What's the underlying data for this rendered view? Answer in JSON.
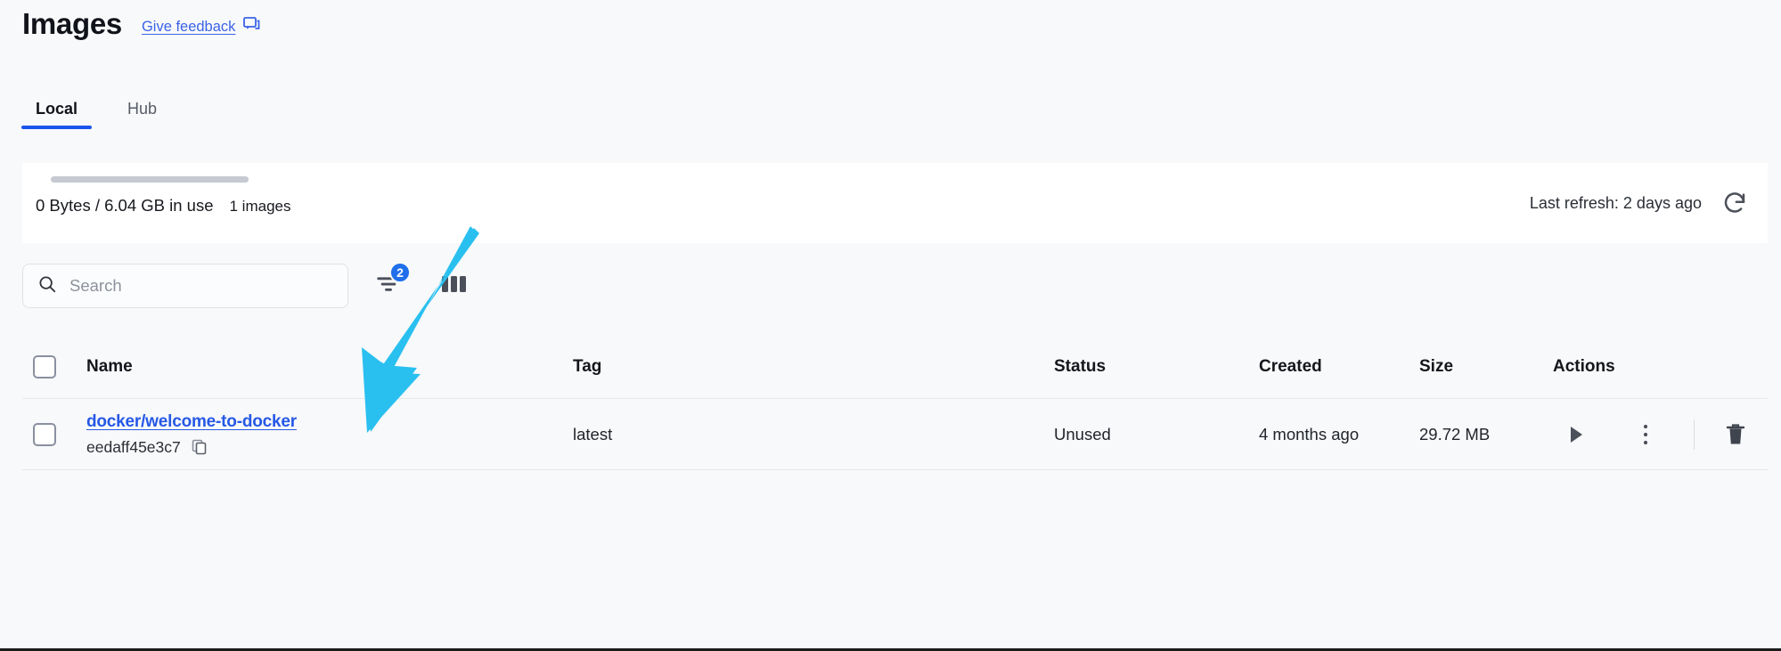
{
  "header": {
    "title": "Images",
    "feedback_label": "Give feedback",
    "feedback_icon": "feedback-message-icon"
  },
  "tabs": [
    {
      "label": "Local",
      "active": true
    },
    {
      "label": "Hub",
      "active": false
    }
  ],
  "usage": {
    "disk_text": "0 Bytes / 6.04 GB in use",
    "image_count_text": "1 images",
    "bar_fill_percent": 0,
    "last_refresh_label": "Last refresh: 2 days ago",
    "refresh_icon": "refresh-icon"
  },
  "toolbar": {
    "search_placeholder": "Search",
    "search_value": "",
    "search_icon": "search-icon",
    "filter_icon": "filter-icon",
    "filter_badge": "2",
    "columns_icon": "columns-icon"
  },
  "table": {
    "columns": [
      "Name",
      "Tag",
      "Status",
      "Created",
      "Size",
      "Actions"
    ],
    "rows": [
      {
        "name": "docker/welcome-to-docker",
        "digest": "eedaff45e3c7",
        "tag": "latest",
        "status": "Unused",
        "created": "4 months ago",
        "size": "29.72 MB",
        "actions": [
          "run-icon",
          "more-vertical-icon",
          "delete-icon"
        ]
      }
    ]
  },
  "colors": {
    "accent_blue": "#1b54ec",
    "link_blue": "#2558e6",
    "badge_blue": "#1f6feb",
    "annotation_cyan": "#29c0f0",
    "page_bg": "#f8f9fa",
    "card_bg": "#ffffff"
  },
  "annotation": {
    "arrow_icon": "pointer-arrow-annotation",
    "points_to": "docker/welcome-to-docker"
  }
}
